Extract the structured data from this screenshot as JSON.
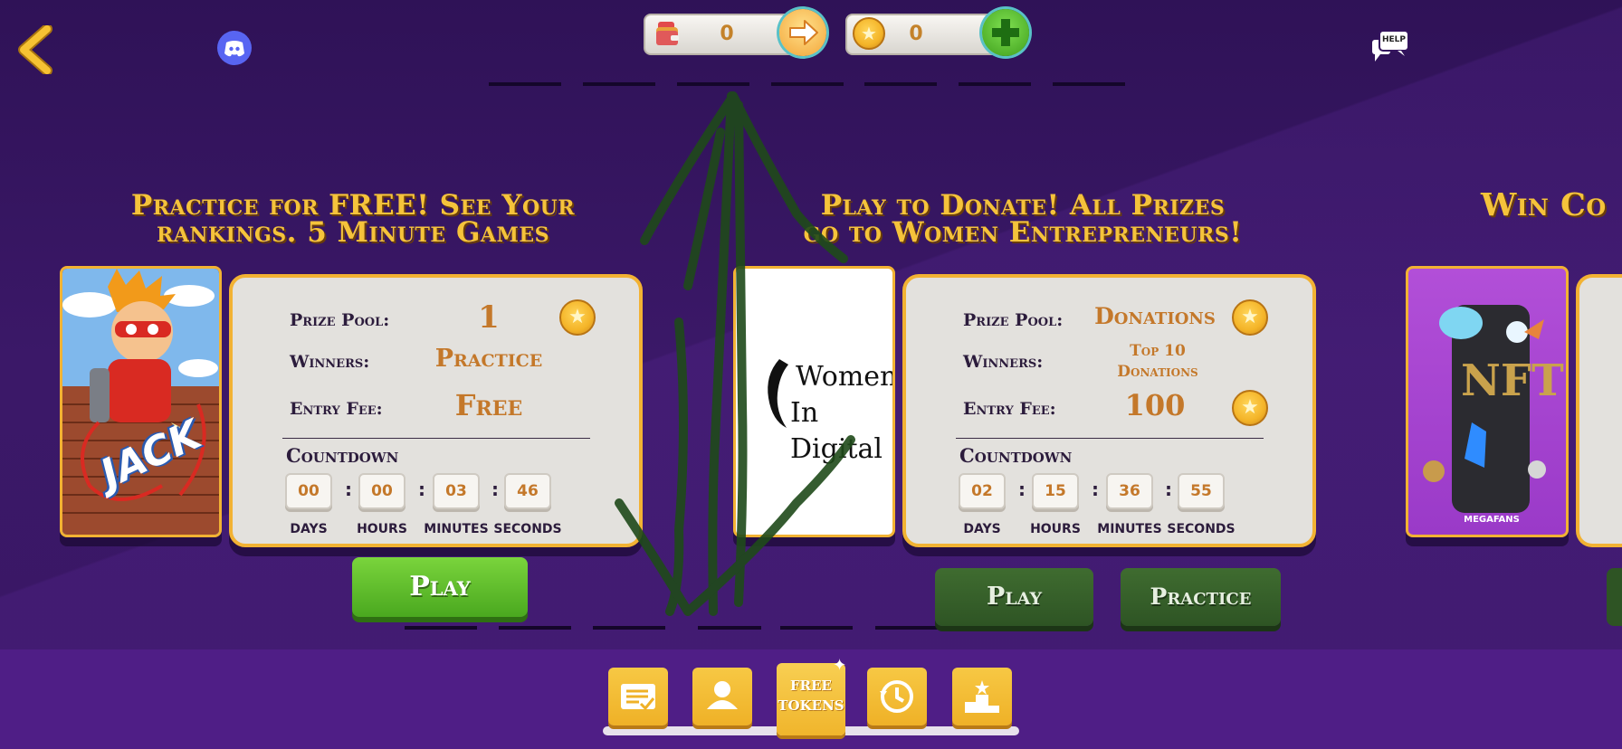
{
  "header": {
    "wallet_count": "0",
    "coin_count": "0",
    "help_label": "HELP"
  },
  "cards": [
    {
      "heading_line1": "Practice for FREE! See Your",
      "heading_line2": "rankings. 5 Minute Games",
      "thumb_text": "JACK",
      "prize_pool_label": "Prize Pool:",
      "prize_pool_value": "1",
      "winners_label": "Winners:",
      "winners_value": "Practice",
      "entry_fee_label": "Entry Fee:",
      "entry_fee_value": "Free",
      "countdown_label": "Countdown",
      "countdown": {
        "days": "00",
        "hours": "00",
        "minutes": "03",
        "seconds": "46"
      },
      "units": {
        "days": "DAYS",
        "hours": "HOURS",
        "minutes": "MINUTES",
        "seconds": "SECONDS"
      },
      "play_label": "Play"
    },
    {
      "heading_line1": "Play to Donate! All Prizes",
      "heading_line2": "go to Women Entrepreneurs!",
      "thumb_line1": "Women",
      "thumb_line2": "In Digital",
      "prize_pool_label": "Prize Pool:",
      "prize_pool_value": "Donations",
      "winners_label": "Winners:",
      "winners_value_line1": "Top 10",
      "winners_value_line2": "Donations",
      "entry_fee_label": "Entry Fee:",
      "entry_fee_value": "100",
      "countdown_label": "Countdown",
      "countdown": {
        "days": "02",
        "hours": "15",
        "minutes": "36",
        "seconds": "55"
      },
      "units": {
        "days": "DAYS",
        "hours": "HOURS",
        "minutes": "MINUTES",
        "seconds": "SECONDS"
      },
      "play_label": "Play",
      "practice_label": "Practice"
    },
    {
      "heading_partial": "Win Co",
      "thumb_text": "NFT",
      "thumb_brand": "MEGAFANS"
    }
  ],
  "nav": {
    "free_tokens_line1": "FREE",
    "free_tokens_line2": "TOKENS"
  },
  "colors": {
    "background": "#34145e",
    "accent_gold": "#f2b233",
    "play_green": "#4aa81f",
    "value_orange": "#c4782a"
  }
}
